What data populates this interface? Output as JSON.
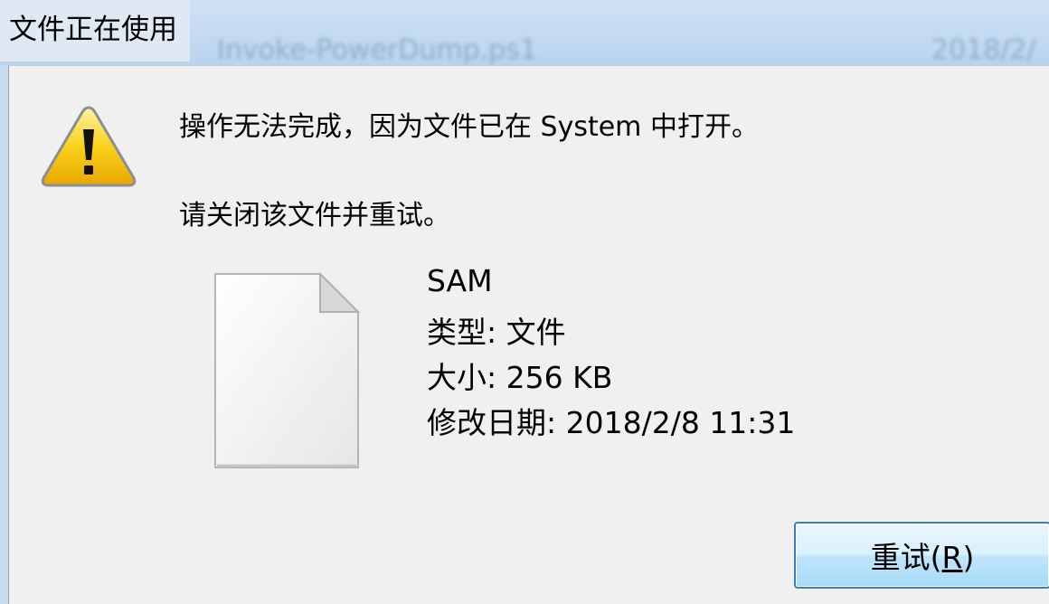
{
  "window": {
    "title": "文件正在使用"
  },
  "background": {
    "ghost_filename": "Invoke-PowerDump.ps1",
    "ghost_date": "2018/2/"
  },
  "message": {
    "line1": "操作无法完成，因为文件已在 System 中打开。",
    "line2": "请关闭该文件并重试。"
  },
  "file": {
    "name": "SAM",
    "type": "类型: 文件",
    "size": "大小: 256 KB",
    "modified": "修改日期: 2018/2/8 11:31"
  },
  "buttons": {
    "retry": {
      "label": "重试(",
      "accelerator": "R",
      "suffix": ")"
    }
  },
  "icons": {
    "warning": "warning-icon",
    "file": "file-icon"
  },
  "colors": {
    "dialog_bg": "#f0f0f0",
    "warning_yellow": "#f5c400",
    "button_border": "#3c7fb1"
  }
}
